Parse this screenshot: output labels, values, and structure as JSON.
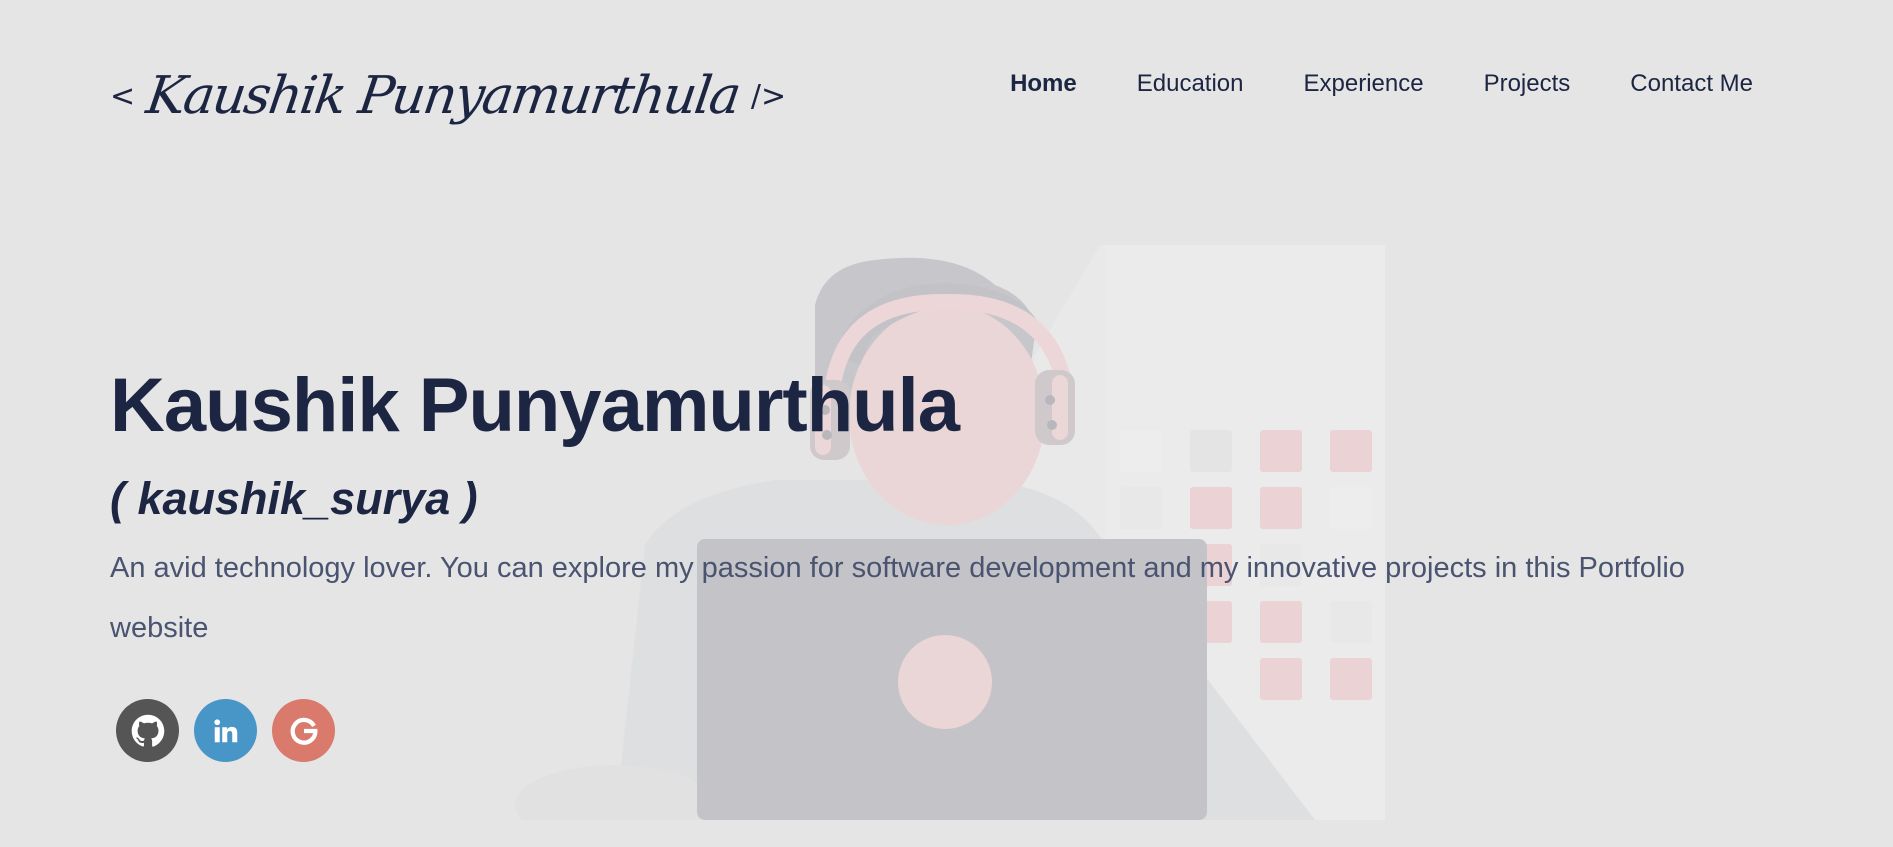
{
  "logo": {
    "open_bracket": "<",
    "signature": "Kaushik Punyamurthula",
    "close_bracket": "/>"
  },
  "nav": {
    "items": [
      {
        "label": "Home",
        "active": true
      },
      {
        "label": "Education"
      },
      {
        "label": "Experience"
      },
      {
        "label": "Projects"
      },
      {
        "label": "Contact Me"
      }
    ]
  },
  "hero": {
    "title": "Kaushik Punyamurthula",
    "handle": "( kaushik_surya )",
    "description": "An avid technology lover. You can explore my passion for software development and my innovative projects in this Portfolio website"
  },
  "socials": [
    {
      "name": "github",
      "color": "#555555",
      "icon": "github-icon"
    },
    {
      "name": "linkedin",
      "color": "#4896c8",
      "icon": "linkedin-icon"
    },
    {
      "name": "google",
      "color": "#d97a6c",
      "icon": "google-icon"
    }
  ],
  "colors": {
    "background": "#e5e5e6",
    "primary_text": "#1c2541",
    "secondary_text": "#4a5470",
    "accent_pink": "#ebd3d5"
  }
}
